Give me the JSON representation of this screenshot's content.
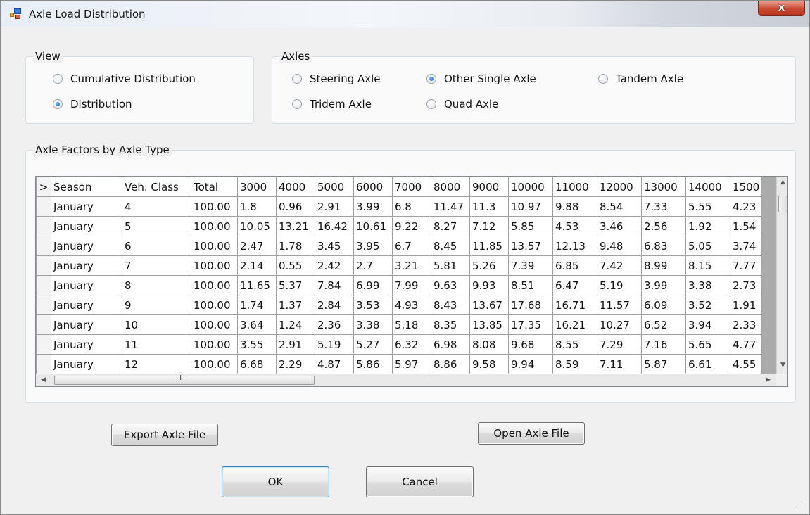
{
  "window": {
    "title": "Axle Load Distribution",
    "close_glyph": "x"
  },
  "view": {
    "label": "View",
    "options": [
      {
        "label": "Cumulative Distribution",
        "checked": false
      },
      {
        "label": "Distribution",
        "checked": true
      }
    ]
  },
  "axles": {
    "label": "Axles",
    "options": [
      {
        "label": "Steering Axle",
        "checked": false
      },
      {
        "label": "Other Single Axle",
        "checked": true
      },
      {
        "label": "Tandem Axle",
        "checked": false
      },
      {
        "label": "Tridem Axle",
        "checked": false
      },
      {
        "label": "Quad Axle",
        "checked": false
      }
    ]
  },
  "factors": {
    "label": "Axle Factors by Axle Type",
    "row_header_marker": ">",
    "columns": [
      "Season",
      "Veh. Class",
      "Total",
      "3000",
      "4000",
      "5000",
      "6000",
      "7000",
      "8000",
      "9000",
      "10000",
      "11000",
      "12000",
      "13000",
      "14000",
      "1500"
    ],
    "rows": [
      [
        "January",
        "4",
        "100.00",
        "1.8",
        "0.96",
        "2.91",
        "3.99",
        "6.8",
        "11.47",
        "11.3",
        "10.97",
        "9.88",
        "8.54",
        "7.33",
        "5.55",
        "4.23"
      ],
      [
        "January",
        "5",
        "100.00",
        "10.05",
        "13.21",
        "16.42",
        "10.61",
        "9.22",
        "8.27",
        "7.12",
        "5.85",
        "4.53",
        "3.46",
        "2.56",
        "1.92",
        "1.54"
      ],
      [
        "January",
        "6",
        "100.00",
        "2.47",
        "1.78",
        "3.45",
        "3.95",
        "6.7",
        "8.45",
        "11.85",
        "13.57",
        "12.13",
        "9.48",
        "6.83",
        "5.05",
        "3.74"
      ],
      [
        "January",
        "7",
        "100.00",
        "2.14",
        "0.55",
        "2.42",
        "2.7",
        "3.21",
        "5.81",
        "5.26",
        "7.39",
        "6.85",
        "7.42",
        "8.99",
        "8.15",
        "7.77"
      ],
      [
        "January",
        "8",
        "100.00",
        "11.65",
        "5.37",
        "7.84",
        "6.99",
        "7.99",
        "9.63",
        "9.93",
        "8.51",
        "6.47",
        "5.19",
        "3.99",
        "3.38",
        "2.73"
      ],
      [
        "January",
        "9",
        "100.00",
        "1.74",
        "1.37",
        "2.84",
        "3.53",
        "4.93",
        "8.43",
        "13.67",
        "17.68",
        "16.71",
        "11.57",
        "6.09",
        "3.52",
        "1.91"
      ],
      [
        "January",
        "10",
        "100.00",
        "3.64",
        "1.24",
        "2.36",
        "3.38",
        "5.18",
        "8.35",
        "13.85",
        "17.35",
        "16.21",
        "10.27",
        "6.52",
        "3.94",
        "2.33"
      ],
      [
        "January",
        "11",
        "100.00",
        "3.55",
        "2.91",
        "5.19",
        "5.27",
        "6.32",
        "6.98",
        "8.08",
        "9.68",
        "8.55",
        "7.29",
        "7.16",
        "5.65",
        "4.77"
      ],
      [
        "January",
        "12",
        "100.00",
        "6.68",
        "2.29",
        "4.87",
        "5.86",
        "5.97",
        "8.86",
        "9.58",
        "9.94",
        "8.59",
        "7.11",
        "5.87",
        "6.61",
        "4.55"
      ]
    ],
    "scroll_up_glyph": "▲",
    "scroll_down_glyph": "▼",
    "scroll_left_glyph": "◀",
    "scroll_right_glyph": "▶",
    "scroll_grip_glyph": "III"
  },
  "buttons": {
    "export": "Export Axle File",
    "open": "Open Axle File",
    "ok": "OK",
    "cancel": "Cancel"
  }
}
